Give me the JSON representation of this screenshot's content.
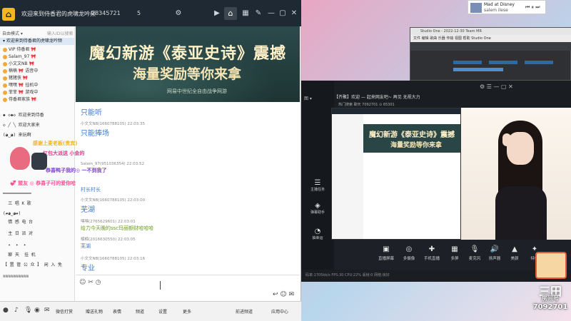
{
  "colors": {
    "accent": "#3d7bcf",
    "titlebar": "#1f2933",
    "home_icon": "#f3b721"
  },
  "titlebar": {
    "title": "欢迎来到侍香君的虎啸龙吟频",
    "room_id": "28345721",
    "count": "5"
  },
  "tree": {
    "header": "自由模式 ▾",
    "header_right": "输入ID以搜索",
    "channel": "▾ 欢迎来到侍香君的虎啸龙吟频",
    "users": [
      {
        "name": "VIP 侍香君 🎀"
      },
      {
        "name": "Salam_97 🎀"
      },
      {
        "name": "小文文NB 🎀"
      },
      {
        "name": "楠楠 🎀 语音中"
      },
      {
        "name": "猪猪侠 🎀"
      },
      {
        "name": "嘿嘿 🎀 挂机中"
      },
      {
        "name": "菲菲 🎀 游戏中"
      },
      {
        "name": "侍香君家族 🎀"
      }
    ],
    "ascii": [
      "◆ ◇◆◇ 欢迎来到侍香",
      "◇ ╱ ╲ 欢迎大家来",
      "(◕‿◕) 来玩啊",
      "━━━━━━━━━━━",
      "  三 唱 K 歌",
      "(▰◕‿◕▰)",
      "  情 感 电 台",
      "  主 日 派 对",
      "  ✦  ✦  ✦",
      "  聊 天  挂 机",
      "【 置 管 公 众 】 闲 入 免",
      "≋≋≋≋≋≋≋≋≋≋"
    ]
  },
  "banner": {
    "title_line1": "魔幻新游《泰亚史诗》震撼",
    "title_line2": "海量奖励等你来拿",
    "sub": "网易中世纪全自由战争网游"
  },
  "chat": {
    "messages": [
      {
        "text": "只能听",
        "kind": "big"
      },
      {
        "meta": "小文文NB(1660788105)  22:03:35"
      },
      {
        "text": "只能捧场",
        "kind": "big"
      },
      {
        "meta": "Salam_97(951036354)  22:03:52"
      },
      {
        "text": "村长村长",
        "kind": "mid",
        "color": "#3d7bcf"
      },
      {
        "meta": "小文文NB(1660788105)  22:03:00"
      },
      {
        "text": "芜湖",
        "kind": "big"
      },
      {
        "meta": "嘿嘿(2765629601)  22:03:01"
      },
      {
        "text": "给力今天晚的ssc玛丽额财哈哈哈",
        "kind": "mid",
        "color": "#6a9a1f"
      },
      {
        "meta": "楠楠(2016630550)  22:03:05"
      },
      {
        "text": "芜湖",
        "kind": "mid",
        "color": "#3d7bcf"
      },
      {
        "meta": "小文文NB(1660788105)  22:03:16"
      },
      {
        "text": "专业",
        "kind": "big"
      }
    ],
    "overlay": [
      {
        "text": "感谢上麦老板(贵宾)",
        "color": "#f2b21c"
      },
      {
        "text": "红包大派送 小金的",
        "color": "#e23c8c"
      },
      {
        "text": "恭喜鸭子我的◎ 一不到我了",
        "color": "#7b3fd0"
      },
      {
        "text": "💞 盟友 ◎ 恭喜子可的爱你哈",
        "color": "#ff4d94"
      }
    ]
  },
  "input": {
    "tools": "☺ ✂ ◷",
    "send": "↩ ☺ ✉"
  },
  "bottombar": {
    "items": [
      "微信打赏",
      "赠送礼物",
      "表情",
      "频道",
      "设置",
      "更多",
      "前进频道",
      "应用中心"
    ]
  },
  "sticker": {
    "line1": "Mad at Disney",
    "line2": "salem ilese"
  },
  "studio": {
    "title": "Studio One - 2022-12-30 Team MR",
    "menu": "文件 编辑 歌曲 乐器 传输 视图 帮助   Studio One"
  },
  "stream": {
    "title": "【齐聚】欢迎 — 起来网友吧~   再见   无视大力",
    "sub": "热门搜索   聊天   7092701   ⊙ 65301",
    "left_label": "图 ▾",
    "panel_items": [
      {
        "icon": "☰",
        "label": "主播任务"
      },
      {
        "icon": "◈",
        "label": "弹幕助手"
      },
      {
        "icon": "◔",
        "label": "抽幸运"
      }
    ],
    "controls": [
      {
        "icon": "▣",
        "label": "直播屏幕"
      },
      {
        "icon": "◎",
        "label": "多摄像"
      },
      {
        "icon": "✚",
        "label": "手机直播"
      },
      {
        "icon": "▦",
        "label": "多屏"
      },
      {
        "icon": "🎙",
        "label": "麦克风"
      },
      {
        "icon": "🔊",
        "label": "扬声器"
      },
      {
        "icon": "▲",
        "label": "美颜"
      },
      {
        "icon": "✦",
        "label": "特效"
      }
    ],
    "footer": "码率:1705kb/s   FPS:30   CPU:22%   丢帧:0   网络:良好"
  },
  "logo": {
    "big": "三田",
    "name": "房间号",
    "id": "7092701"
  }
}
